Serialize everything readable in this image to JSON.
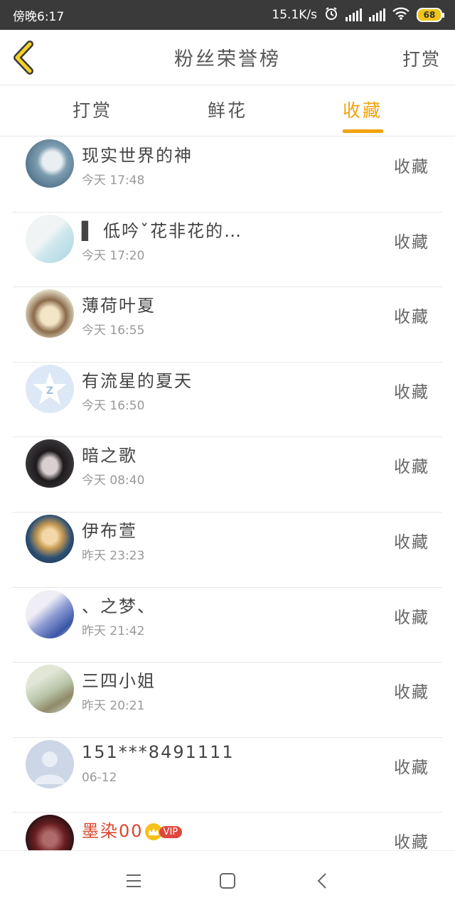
{
  "status_bar": {
    "time": "傍晚6:17",
    "net_speed": "15.1K/s",
    "battery": "68",
    "icons": [
      "alarm-icon",
      "signal-icon",
      "signal-icon",
      "wifi-icon",
      "battery-icon"
    ]
  },
  "header": {
    "title": "粉丝荣誉榜",
    "action": "打赏",
    "back_icon": "chevron-left-icon"
  },
  "tabs": [
    {
      "label": "打赏"
    },
    {
      "label": "鲜花"
    },
    {
      "label": "收藏",
      "active": true
    }
  ],
  "accent_color": "#f2a20c",
  "list": [
    {
      "name": "现实世界的神",
      "time": "今天 17:48",
      "type": "收藏"
    },
    {
      "name": "▌ 低吟ˇ花非花的…",
      "time": "今天 17:20",
      "type": "收藏"
    },
    {
      "name": "薄荷叶夏",
      "time": "今天 16:55",
      "type": "收藏"
    },
    {
      "name": "有流星的夏天",
      "time": "今天 16:50",
      "type": "收藏"
    },
    {
      "name": "暗之歌",
      "time": "今天 08:40",
      "type": "收藏"
    },
    {
      "name": "伊布萱",
      "time": "昨天 23:23",
      "type": "收藏"
    },
    {
      "name": "、之梦、",
      "time": "昨天 21:42",
      "type": "收藏"
    },
    {
      "name": "三四小姐",
      "time": "昨天 20:21",
      "type": "收藏"
    },
    {
      "name": "151***8491111",
      "time": "06-12",
      "type": "收藏"
    },
    {
      "name": "墨染00",
      "time": "",
      "type": "收藏",
      "vip": "VIP"
    }
  ],
  "nav": {
    "icons": [
      "menu-icon",
      "home-icon",
      "back-icon"
    ]
  }
}
